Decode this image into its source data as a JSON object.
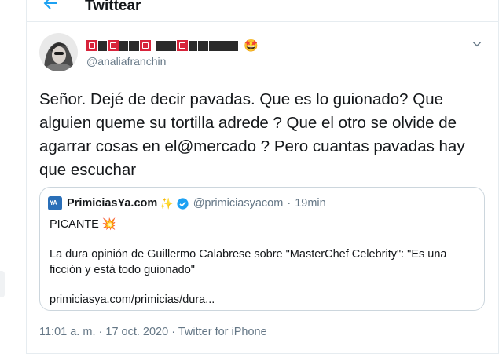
{
  "header": {
    "title": "Twittear",
    "back_icon": "arrow-left-icon"
  },
  "colors": {
    "accent": "#1da1f2",
    "secondary_text": "#657786",
    "border": "#e6ecf0"
  },
  "tweet": {
    "author_handle": "@analiafranchin",
    "author_name_emoji": "🤩",
    "text": "Señor. Dejé de decir pavadas. Que es lo guionado? Que alguien queme su tortilla adrede ? Que el otro se olvide de agarrar cosas en el@mercado ? Pero cuantas pavadas hay que escuchar",
    "time": "11:01 a. m.",
    "date": "17 oct. 2020",
    "source": "Twitter for iPhone",
    "separator": "·"
  },
  "quote": {
    "name": "PrimiciasYa.com",
    "sparkle": "✨",
    "handle": "@primiciasyacom",
    "time": "19min",
    "separator": "·",
    "logo_text": "YA",
    "line1": "PICANTE",
    "line1_emoji": "💥",
    "line2": "La dura opinión de Guillermo Calabrese sobre \"MasterChef Celebrity\": \"Es una",
    "line3": "ficción y está todo guionado\"",
    "link": "primiciasya.com/primicias/dura..."
  }
}
